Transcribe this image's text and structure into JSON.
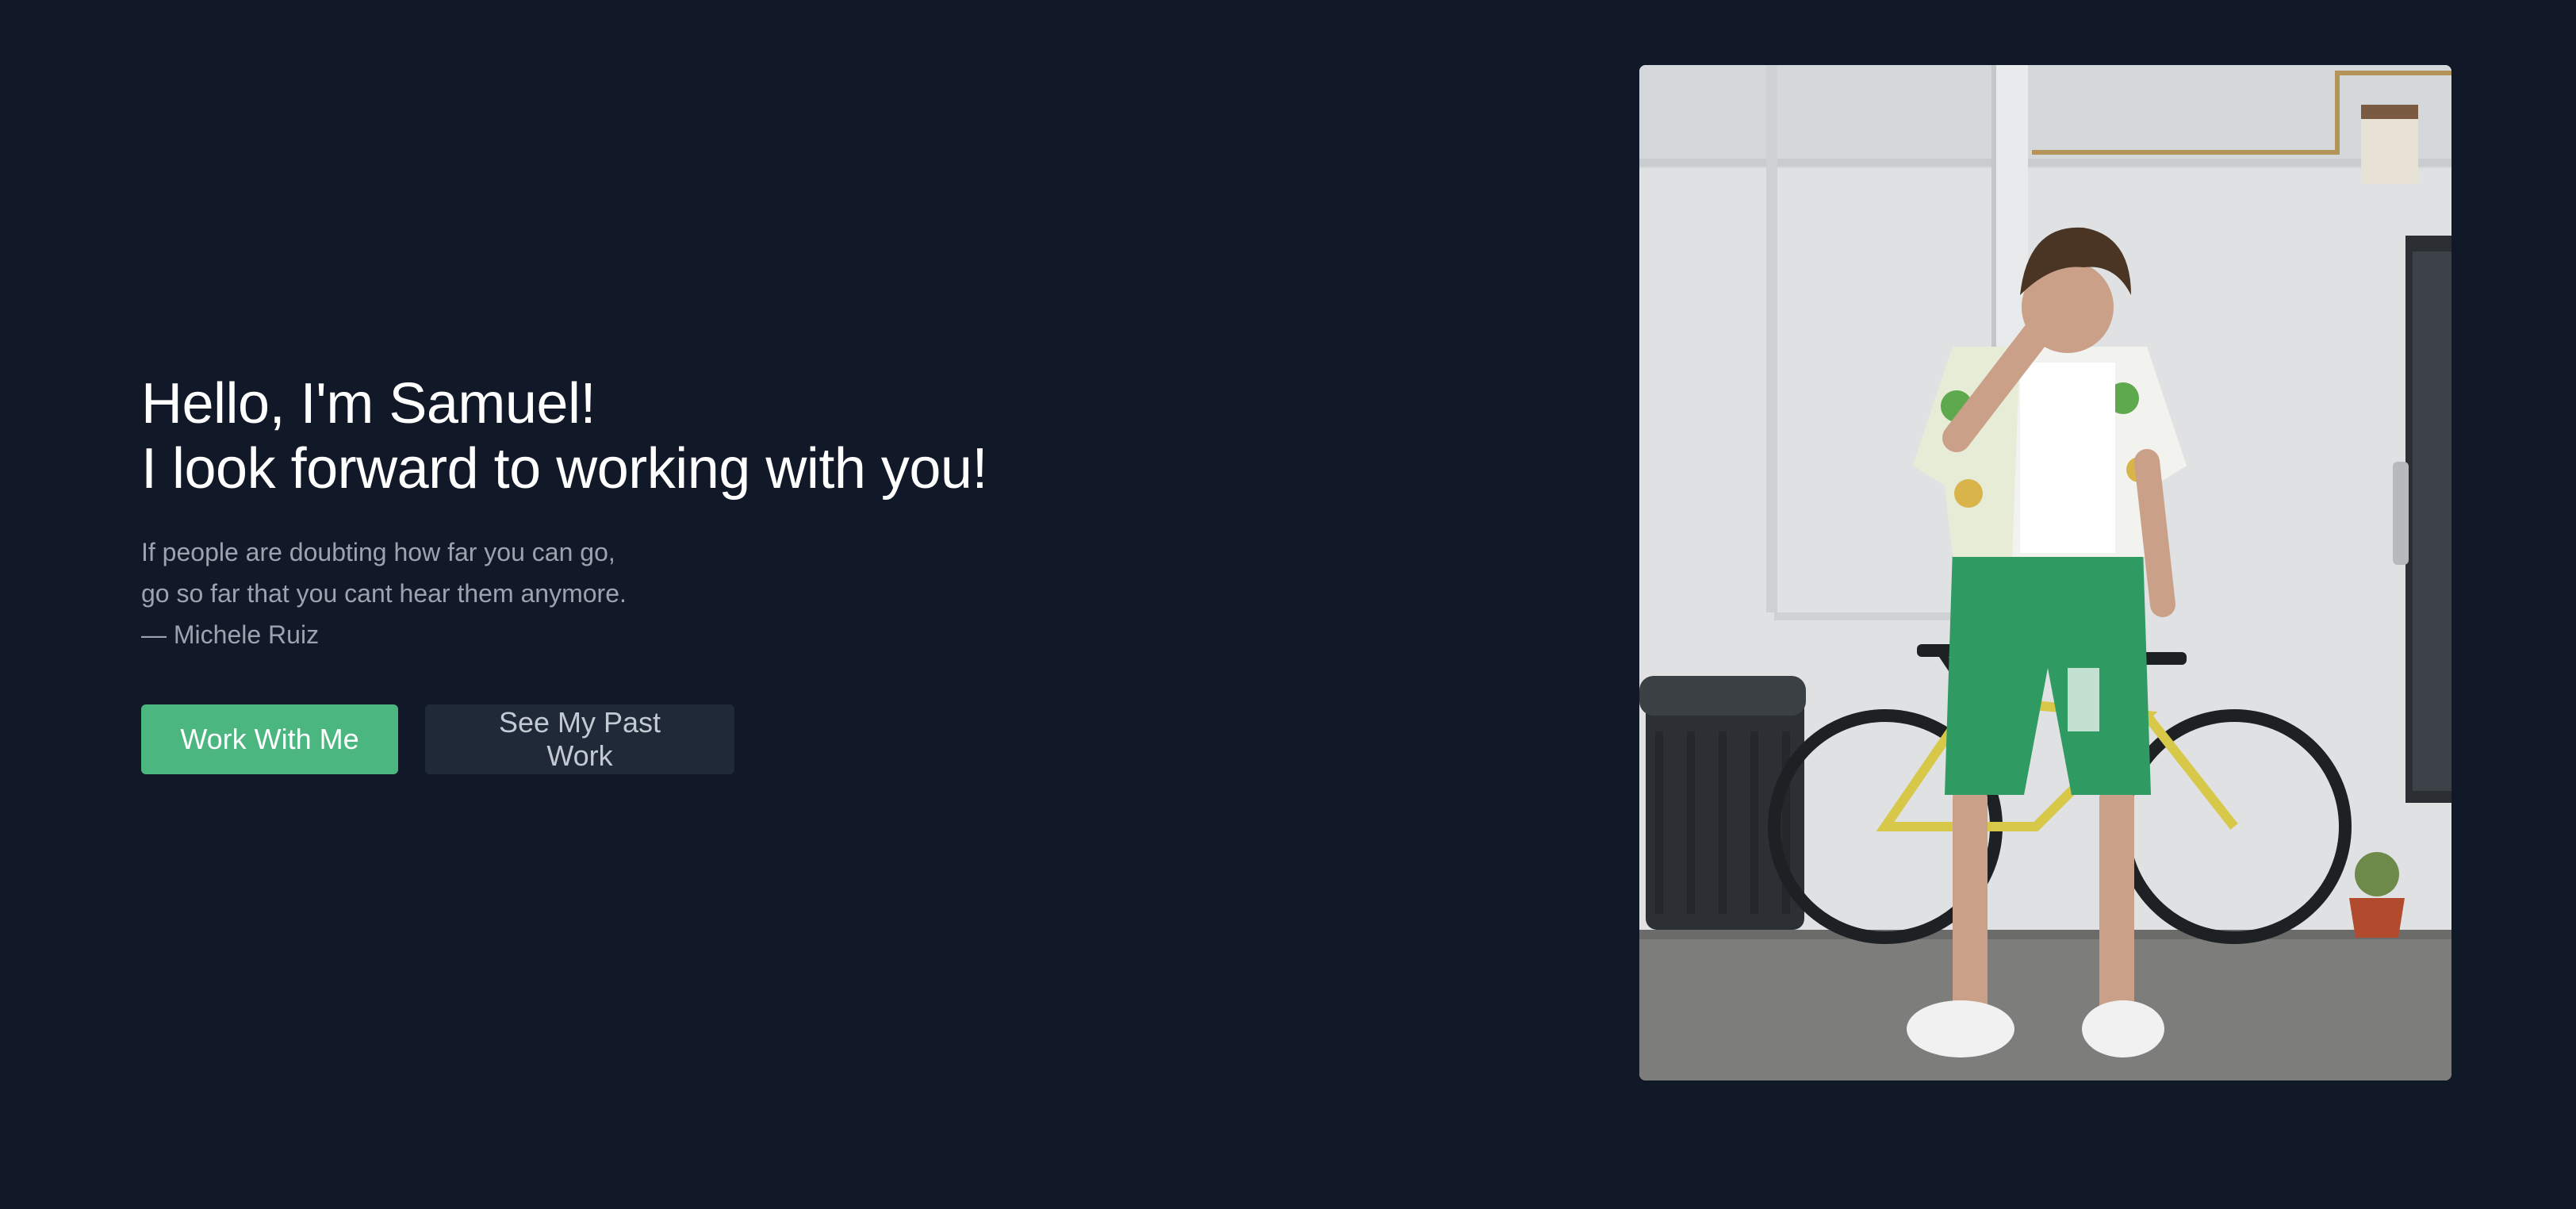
{
  "hero": {
    "greeting": "Hello, I'm Samuel!",
    "tagline": "I look forward to working with you!",
    "quote_line_1": "If people are doubting how far you can go,",
    "quote_line_2": "go so far that you cant hear them anymore.",
    "quote_author": "— Michele Ruiz",
    "primary_button": "Work With Me",
    "secondary_button": "See My Past Work"
  },
  "colors": {
    "background": "#111827",
    "accent": "#4cb680",
    "secondary_button": "#1f2937",
    "muted_text": "#9ca3af"
  }
}
